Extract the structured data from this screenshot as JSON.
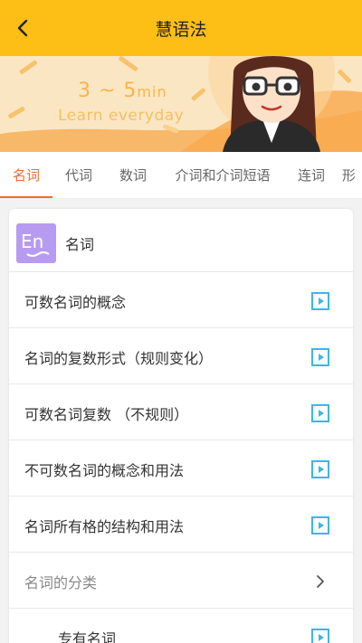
{
  "header": {
    "title": "慧语法",
    "back_icon": "chevron-left-icon"
  },
  "banner": {
    "line1_main": "3 ~ 5",
    "line1_unit": "min",
    "line2": "Learn everyday"
  },
  "tabs": [
    {
      "label": "名词",
      "active": true
    },
    {
      "label": "代词",
      "active": false
    },
    {
      "label": "数词",
      "active": false
    },
    {
      "label": "介词和介词短语",
      "active": false
    },
    {
      "label": "连词",
      "active": false
    },
    {
      "label": "形",
      "active": false
    }
  ],
  "card": {
    "logo_text": "En",
    "title": "名词",
    "rows": [
      {
        "label": "可数名词的概念",
        "icon": "play-icon"
      },
      {
        "label": "名词的复数形式（规则变化）",
        "icon": "play-icon"
      },
      {
        "label": "可数名词复数 （不规则）",
        "icon": "play-icon"
      },
      {
        "label": "不可数名词的概念和用法",
        "icon": "play-icon"
      },
      {
        "label": "名词所有格的结构和用法",
        "icon": "play-icon"
      },
      {
        "label": "名词的分类",
        "icon": "chevron-right-icon"
      },
      {
        "label": "专有名词",
        "icon": "play-icon"
      }
    ]
  },
  "colors": {
    "header_bg": "#fdbf16",
    "accent": "#f06a34",
    "play_icon": "#3cb6e6",
    "logo_bg": "#b79bf0"
  }
}
